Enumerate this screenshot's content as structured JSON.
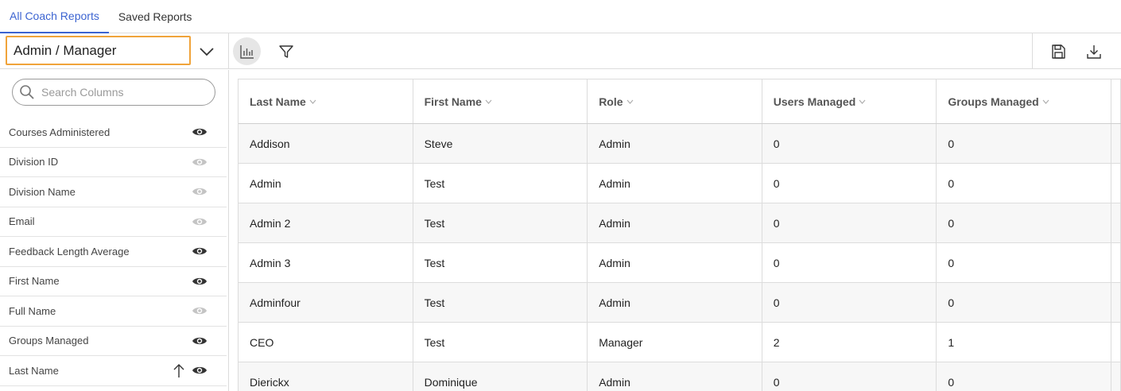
{
  "tabs": [
    {
      "label": "All Coach Reports",
      "active": true
    },
    {
      "label": "Saved Reports",
      "active": false
    }
  ],
  "toolbar": {
    "report_select_value": "Admin / Manager",
    "chart_icon": "bar-chart-icon",
    "filter_icon": "filter-icon",
    "save_icon": "save-icon",
    "download_icon": "download-icon"
  },
  "sidebar": {
    "search_placeholder": "Search Columns",
    "columns": [
      {
        "label": "Courses Administered",
        "visible": true,
        "sorted": false
      },
      {
        "label": "Division ID",
        "visible": false,
        "sorted": false
      },
      {
        "label": "Division Name",
        "visible": false,
        "sorted": false
      },
      {
        "label": "Email",
        "visible": false,
        "sorted": false
      },
      {
        "label": "Feedback Length Average",
        "visible": true,
        "sorted": false
      },
      {
        "label": "First Name",
        "visible": true,
        "sorted": false
      },
      {
        "label": "Full Name",
        "visible": false,
        "sorted": false
      },
      {
        "label": "Groups Managed",
        "visible": true,
        "sorted": false
      },
      {
        "label": "Last Name",
        "visible": true,
        "sorted": true
      }
    ]
  },
  "table": {
    "headers": [
      "Last Name",
      "First Name",
      "Role",
      "Users Managed",
      "Groups Managed"
    ],
    "rows": [
      [
        "Addison",
        "Steve",
        "Admin",
        "0",
        "0"
      ],
      [
        "Admin",
        "Test",
        "Admin",
        "0",
        "0"
      ],
      [
        "Admin 2",
        "Test",
        "Admin",
        "0",
        "0"
      ],
      [
        "Admin 3",
        "Test",
        "Admin",
        "0",
        "0"
      ],
      [
        "Adminfour",
        "Test",
        "Admin",
        "0",
        "0"
      ],
      [
        "CEO",
        "Test",
        "Manager",
        "2",
        "1"
      ],
      [
        "Dierickx",
        "Dominique",
        "Admin",
        "0",
        "0"
      ]
    ]
  },
  "colors": {
    "accent": "#3b63d1",
    "select_border": "#f0a33a",
    "eye_visible": "#333333",
    "eye_hidden": "#c4c4c4"
  }
}
